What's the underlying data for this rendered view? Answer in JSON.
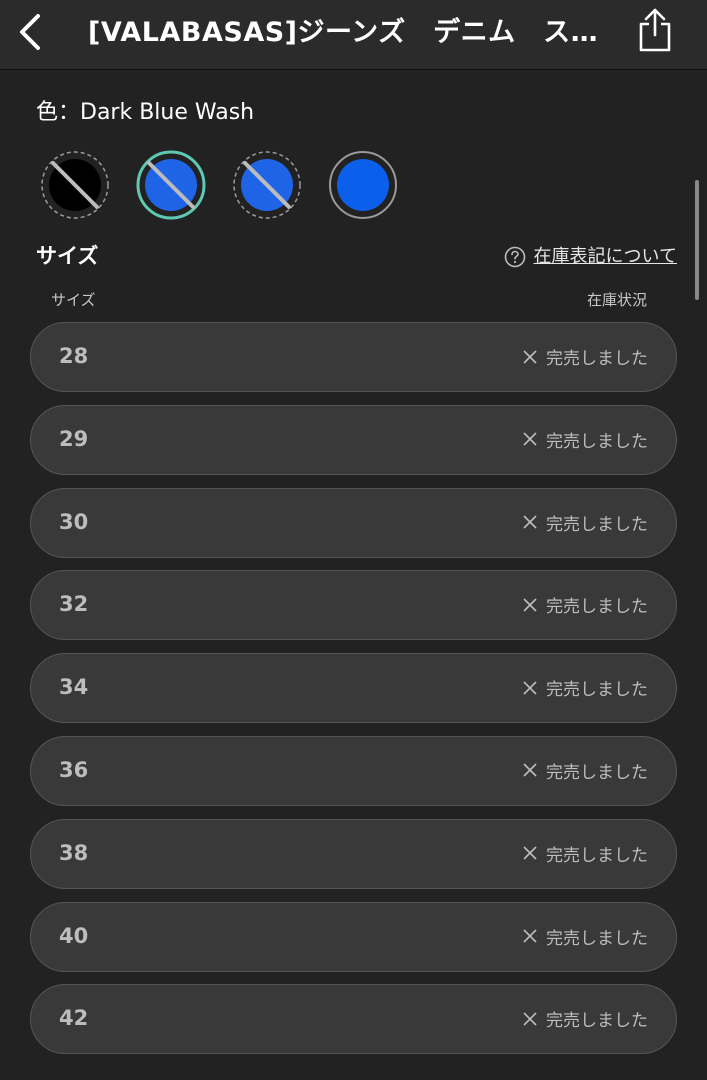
{
  "header": {
    "title": "[VALABASAS]ジーンズ　デニム　ス…",
    "back_icon": "chevron-left-icon",
    "share_icon": "share-icon"
  },
  "color": {
    "label": "色：Dark Blue Wash",
    "swatches": [
      {
        "name": "black",
        "fill": "#000000",
        "sold_out": true,
        "selected": false
      },
      {
        "name": "blue",
        "fill": "#1f63e6",
        "sold_out": true,
        "selected": true
      },
      {
        "name": "blue",
        "fill": "#1f63e6",
        "sold_out": true,
        "selected": false
      },
      {
        "name": "blue",
        "fill": "#0b5fea",
        "sold_out": false,
        "selected": false
      }
    ],
    "selected_ring_color": "#5fc8b3"
  },
  "size": {
    "title": "サイズ",
    "stock_help": "在庫表記について",
    "col_size": "サイズ",
    "col_stock": "在庫状況",
    "rows": [
      {
        "size": "28",
        "status": "完売しました"
      },
      {
        "size": "29",
        "status": "完売しました"
      },
      {
        "size": "30",
        "status": "完売しました"
      },
      {
        "size": "32",
        "status": "完売しました"
      },
      {
        "size": "34",
        "status": "完売しました"
      },
      {
        "size": "36",
        "status": "完売しました"
      },
      {
        "size": "38",
        "status": "完売しました"
      },
      {
        "size": "40",
        "status": "完売しました"
      },
      {
        "size": "42",
        "status": "完売しました"
      }
    ]
  }
}
